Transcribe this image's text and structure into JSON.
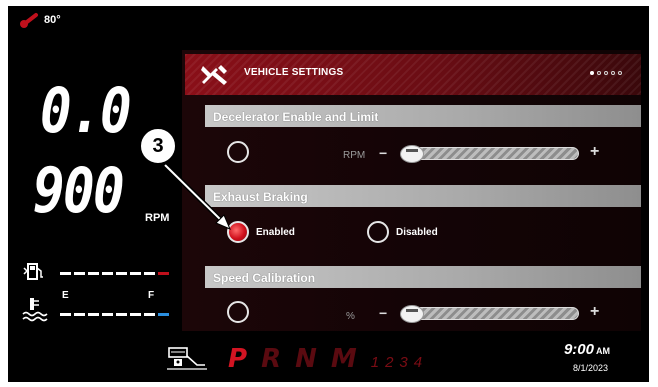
{
  "status": {
    "temperature": "80°"
  },
  "gauges": {
    "speed": "0.0",
    "rpm": "900",
    "rpm_unit": "RPM",
    "fuel_empty": "E",
    "fuel_full": "F"
  },
  "settings": {
    "title": "VEHICLE SETTINGS",
    "page_dots": [
      true,
      false,
      false,
      false,
      false
    ],
    "decelerator": {
      "label": "Decelerator Enable and Limit",
      "unit": "RPM",
      "minus": "−",
      "plus": "+",
      "level": 0.05
    },
    "exhaust": {
      "label": "Exhaust Braking",
      "enabled_label": "Enabled",
      "disabled_label": "Disabled",
      "selected": "Enabled"
    },
    "speed_calibration": {
      "label": "Speed Calibration",
      "unit": "%",
      "minus": "−",
      "plus": "+",
      "level": 0.05
    }
  },
  "callout": {
    "number": "3"
  },
  "bottom": {
    "gears": [
      "P",
      "R",
      "N",
      "M"
    ],
    "gear_active": "P",
    "manual_gears": "1234",
    "time": "9:00",
    "ampm": "AM",
    "date": "8/1/2023"
  },
  "colors": {
    "accent": "#d21422",
    "header": "#8a0f18",
    "coolant_marker": "#2b8fe0"
  }
}
